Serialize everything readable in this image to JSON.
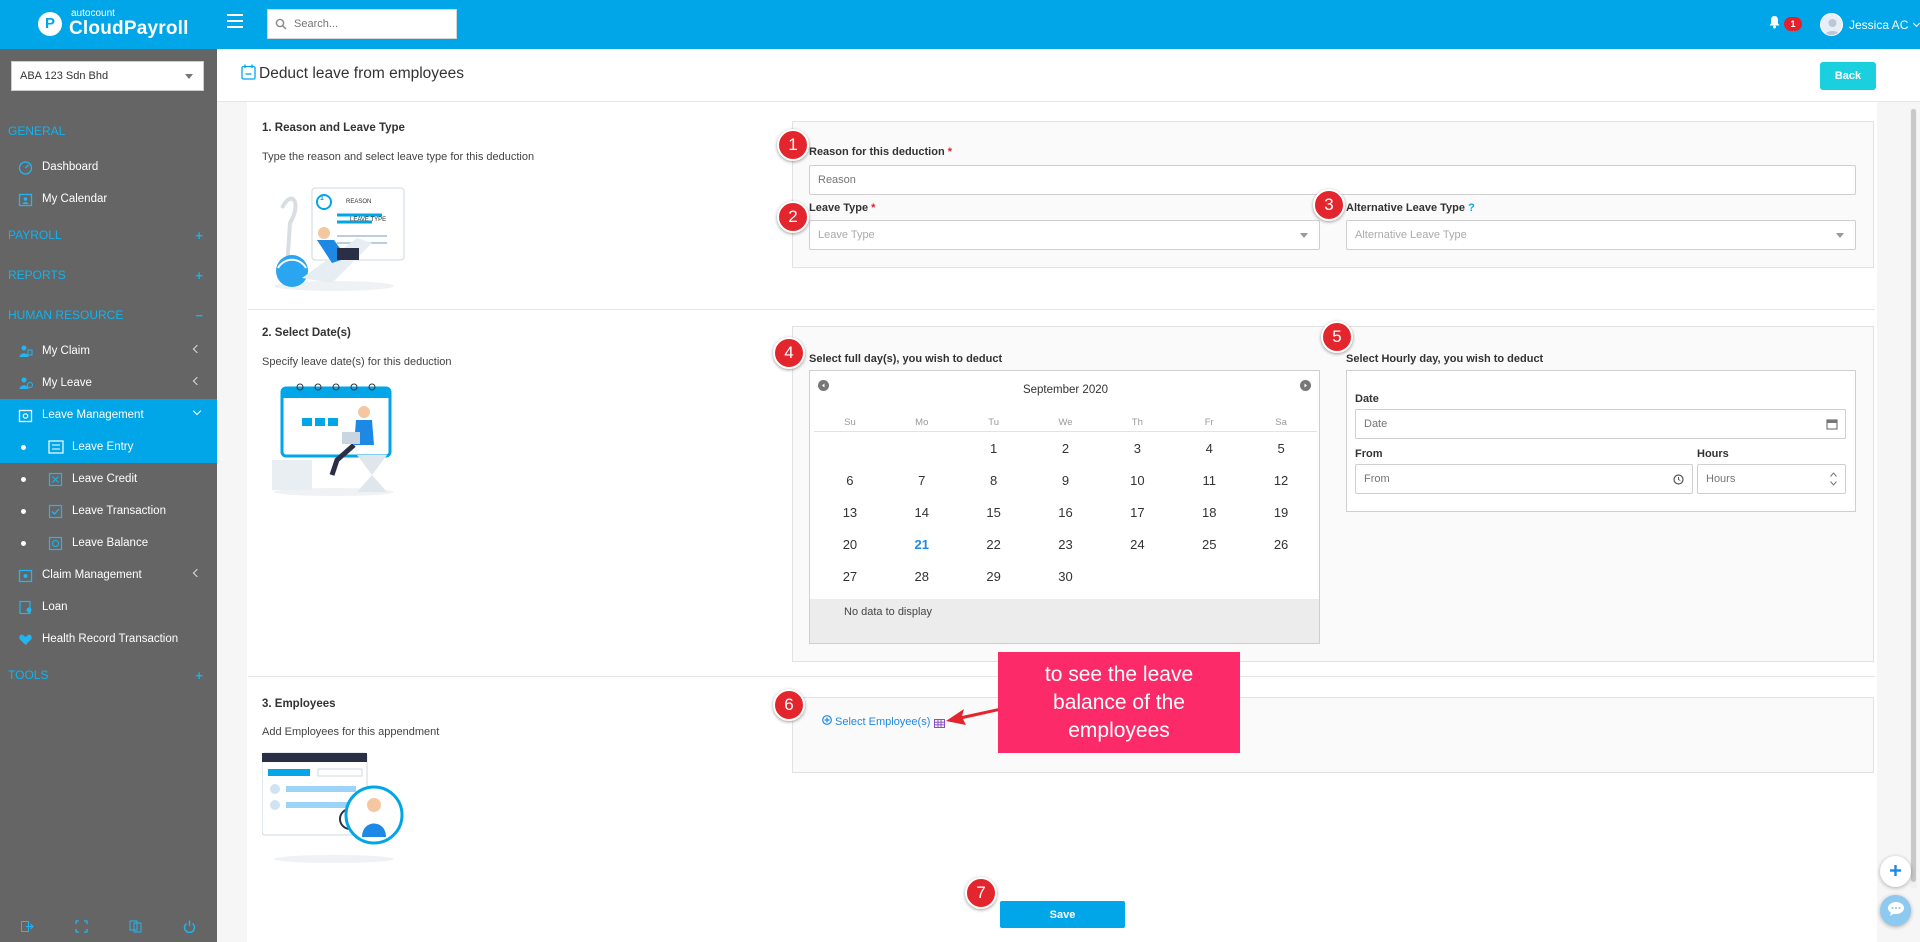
{
  "app": {
    "logo_sub": "autocount",
    "logo_main": "CloudPayroll",
    "logo_letter": "P"
  },
  "header": {
    "search_placeholder": "Search...",
    "notification_count": "1",
    "user_name": "Jessica AC"
  },
  "sidebar": {
    "company": "ABA 123 Sdn Bhd",
    "sections": {
      "general": "GENERAL",
      "payroll": "PAYROLL",
      "reports": "REPORTS",
      "human_resource": "HUMAN RESOURCE",
      "tools": "TOOLS"
    },
    "items": {
      "dashboard": "Dashboard",
      "my_calendar": "My Calendar",
      "my_claim": "My Claim",
      "my_leave": "My Leave",
      "leave_management": "Leave Management",
      "leave_entry": "Leave Entry",
      "leave_credit": "Leave Credit",
      "leave_transaction": "Leave Transaction",
      "leave_balance": "Leave Balance",
      "claim_management": "Claim Management",
      "loan": "Loan",
      "health_record": "Health Record Transaction"
    }
  },
  "page": {
    "title": "Deduct leave from employees",
    "back_label": "Back",
    "save_label": "Save"
  },
  "section1": {
    "title": "1. Reason and Leave Type",
    "desc": "Type the reason and select leave type for this deduction",
    "illus_reason": "REASON",
    "illus_leave_type": "LEAVE TYPE",
    "illus_step": "1",
    "reason_label": "Reason for this deduction",
    "reason_placeholder": "Reason",
    "leave_type_label": "Leave Type",
    "leave_type_placeholder": "Leave Type",
    "alt_leave_label": "Alternative Leave Type",
    "alt_leave_placeholder": "Alternative Leave Type",
    "required_mark": "*",
    "help_mark": "?"
  },
  "section2": {
    "title": "2. Select Date(s)",
    "desc": "Specify leave date(s) for this deduction",
    "full_day_label": "Select full day(s), you wish to deduct",
    "hourly_label": "Select Hourly day, you wish to deduct",
    "calendar": {
      "month": "September 2020",
      "weekdays": [
        "Su",
        "Mo",
        "Tu",
        "We",
        "Th",
        "Fr",
        "Sa"
      ],
      "weeks": [
        [
          "",
          "",
          "1",
          "2",
          "3",
          "4",
          "5"
        ],
        [
          "6",
          "7",
          "8",
          "9",
          "10",
          "11",
          "12"
        ],
        [
          "13",
          "14",
          "15",
          "16",
          "17",
          "18",
          "19"
        ],
        [
          "20",
          "21",
          "22",
          "23",
          "24",
          "25",
          "26"
        ],
        [
          "27",
          "28",
          "29",
          "30",
          "",
          "",
          ""
        ]
      ],
      "today": "21",
      "no_data": "No data to display"
    },
    "date_label": "Date",
    "date_placeholder": "Date",
    "from_label": "From",
    "from_placeholder": "From",
    "hours_label": "Hours",
    "hours_placeholder": "Hours"
  },
  "section3": {
    "title": "3. Employees",
    "desc": "Add Employees for this appendment",
    "select_label": "Select Employee(s)"
  },
  "annotations": {
    "markers": [
      "1",
      "2",
      "3",
      "4",
      "5",
      "6",
      "7"
    ],
    "callout": "to see the leave balance of the employees"
  },
  "colors": {
    "brand": "#01a6e8",
    "sidebar": "#656565",
    "marker": "#e3262d",
    "callout": "#fd2a6a",
    "back_button": "#1ad0de"
  },
  "icons": {
    "search": "search-icon",
    "bell": "bell-icon",
    "calendar": "calendar-icon",
    "clock": "clock-icon",
    "table": "table-icon",
    "plus": "plus-icon",
    "chat": "chat-icon"
  }
}
